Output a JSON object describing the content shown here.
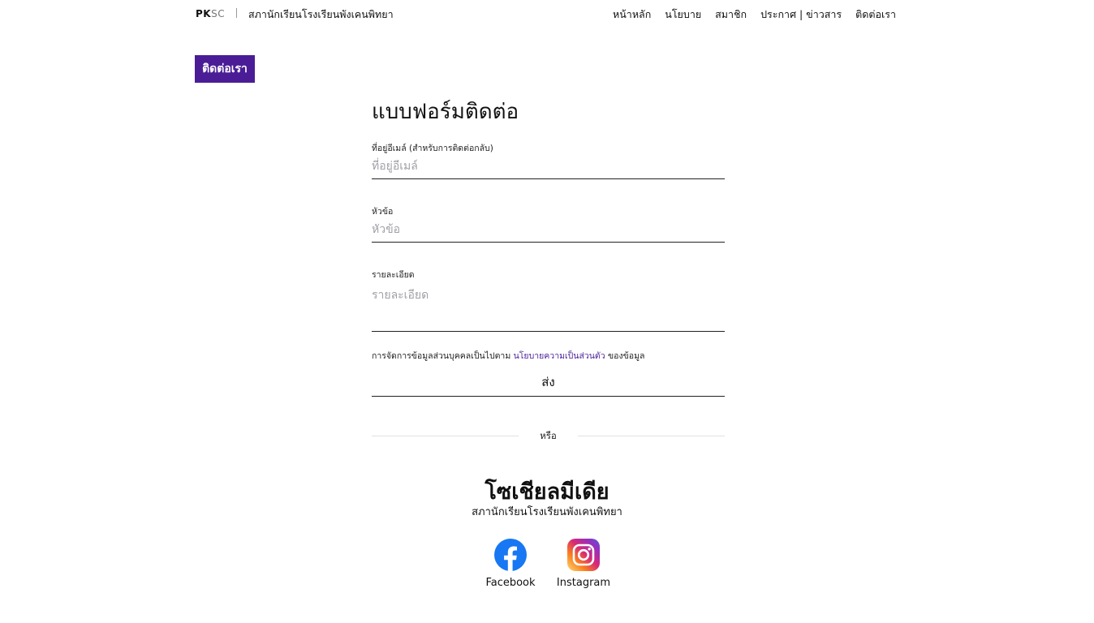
{
  "header": {
    "logo": {
      "bold": "PK",
      "rest": "SC"
    },
    "site_name": "สภานักเรียนโรงเรียนพังเคนพิทยา",
    "nav": [
      "หน้าหลัก",
      "นโยบาย",
      "สมาชิก",
      "ประกาศ | ข่าวสาร",
      "ติดต่อเรา"
    ]
  },
  "contact_tag": "ติดต่อเรา",
  "form": {
    "title": "แบบฟอร์มติดต่อ",
    "email": {
      "label": "ที่อยู่อีเมล์ (สำหรับการติดต่อกลับ)",
      "placeholder": "ที่อยู่อีเมล์",
      "value": ""
    },
    "subject": {
      "label": "หัวข้อ",
      "placeholder": "หัวข้อ",
      "value": ""
    },
    "details": {
      "label": "รายละเอียด",
      "placeholder": "รายละเอียด",
      "value": ""
    },
    "privacy": {
      "prefix": "การจัดการข้อมูลส่วนบุคคลเป็นไปตาม",
      "link": "นโยบายความเป็นส่วนตัว",
      "suffix": "ของข้อมูล"
    },
    "submit_label": "ส่ง",
    "or_text": "หรือ"
  },
  "social": {
    "title": "โซเชียลมีเดีย",
    "subtitle": "สภานักเรียนโรงเรียนพังเคนพิทยา",
    "items": [
      {
        "name": "Facebook",
        "icon": "facebook-icon",
        "color": "#1877f2"
      },
      {
        "name": "Instagram",
        "icon": "instagram-icon",
        "color": "#dd2a7b"
      }
    ]
  },
  "colors": {
    "accent": "#4a1d96",
    "placeholder": "#a0a0a8"
  }
}
